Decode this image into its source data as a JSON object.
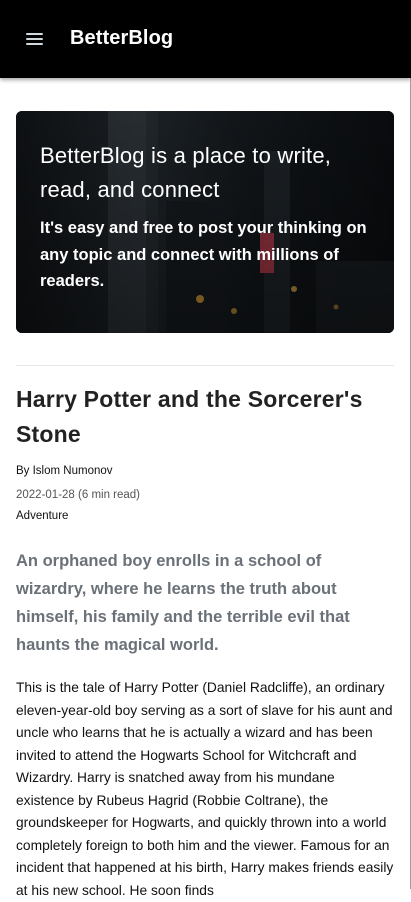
{
  "appbar": {
    "brand": "BetterBlog",
    "menu_icon": "hamburger-menu-icon",
    "background": "#000000"
  },
  "hero": {
    "title": "BetterBlog is a place to write, read, and connect",
    "subtitle": "It's easy and free to post your thinking on any topic and connect with millions of readers."
  },
  "post": {
    "title": "Harry Potter and the Sorcerer's Stone",
    "author": "By Islom Numonov",
    "date_read": "2022-01-28 (6 min read)",
    "category": "Adventure",
    "lead": "An orphaned boy enrolls in a school of wizardry, where he learns the truth about himself, his family and the terrible evil that haunts the magical world.",
    "body": "This is the tale of Harry Potter (Daniel Radcliffe), an ordinary eleven-year-old boy serving as a sort of slave for his aunt and uncle who learns that he is actually a wizard and has been invited to attend the Hogwarts School for Witchcraft and Wizardry. Harry is snatched away from his mundane existence by Rubeus Hagrid (Robbie Coltrane), the groundskeeper for Hogwarts, and quickly thrown into a world completely foreign to both him and the viewer. Famous for an incident that happened at his birth, Harry makes friends easily at his new school. He soon finds"
  }
}
